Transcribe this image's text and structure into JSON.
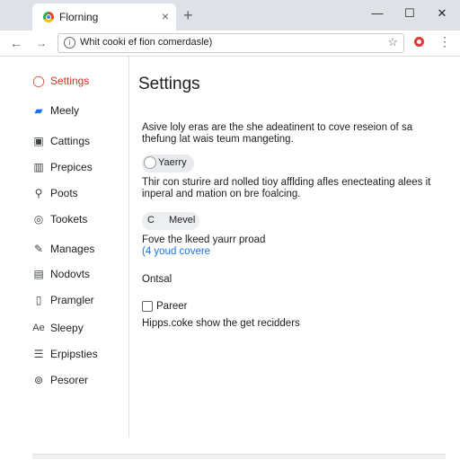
{
  "browser": {
    "tab": {
      "title": "Florning",
      "close": "×"
    },
    "new_tab": "+",
    "window_controls": {
      "minimize": "—",
      "maximize": "☐",
      "close": "✕"
    },
    "nav": {
      "back": "←",
      "forward": "→",
      "reload": "↻"
    },
    "omnibox": {
      "info": "i",
      "url": "Whit cooki ef fion comerdasle)",
      "star": "☆"
    },
    "menu": "⋮"
  },
  "sidebar": {
    "items": [
      {
        "label": "Settings",
        "icon": "◯",
        "icon_name": "settings-circle-icon",
        "active": true
      },
      {
        "label": "Meely",
        "icon": "▰",
        "icon_name": "card-icon"
      },
      {
        "label": "Cattings",
        "icon": "▣",
        "icon_name": "document-icon"
      },
      {
        "label": "Prepices",
        "icon": "▥",
        "icon_name": "grid-icon"
      },
      {
        "label": "Poots",
        "icon": "⚲",
        "icon_name": "key-icon"
      },
      {
        "label": "Tookets",
        "icon": "◎",
        "icon_name": "target-icon"
      },
      {
        "label": "Manages",
        "icon": "✎",
        "icon_name": "hand-icon"
      },
      {
        "label": "Nodovts",
        "icon": "▤",
        "icon_name": "folder-icon"
      },
      {
        "label": "Pramgler",
        "icon": "▯",
        "icon_name": "phone-icon"
      },
      {
        "label": "Sleepy",
        "icon": "Ae",
        "icon_name": "text-icon"
      },
      {
        "label": "Erpipsties",
        "icon": "☰",
        "icon_name": "list-icon"
      },
      {
        "label": "Pesorer",
        "icon": "⊚",
        "icon_name": "record-icon"
      }
    ]
  },
  "main": {
    "title": "Settings",
    "description_line1": "Asive loly eras are the she adeatinent to cove reseion of sa",
    "description_line2": "thefung lat wais teum mangeting.",
    "toggle1_label": "Yaerry",
    "description2_line1": "Thir con sturire ard nolled tioy afflding afles enecteating alees it",
    "description2_line2": "inperal and mation on bre foalcing.",
    "toggle2_icon": "C",
    "toggle2_label": "Mevel",
    "row_text": "Fove the lkeed yaurr proad",
    "link_text": "(4 youd covere",
    "section_label": "Ontsal",
    "checkbox_label": "Pareer",
    "footer_text": "Hipps.coke show the get recidders"
  }
}
